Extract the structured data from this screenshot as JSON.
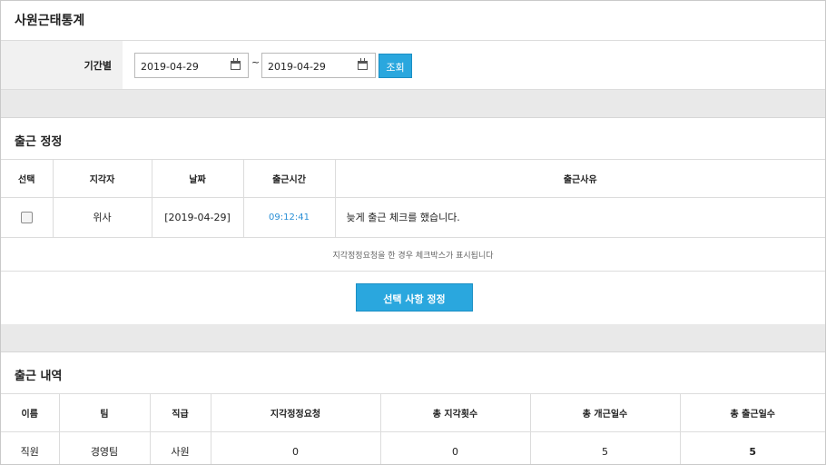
{
  "page": {
    "title": "사원근태통계"
  },
  "filter": {
    "label": "기간별",
    "start_date": "2019-04-29",
    "separator": "~",
    "end_date": "2019-04-29",
    "search_label": "조회"
  },
  "correction": {
    "title": "출근 정정",
    "columns": [
      "선택",
      "지각자",
      "날짜",
      "출근시간",
      "출근사유"
    ],
    "rows": [
      {
        "checked": false,
        "name": "위사",
        "date": "[2019-04-29]",
        "time": "09:12:41",
        "reason": "늦게 출근 체크를 했습니다."
      }
    ],
    "notice": "지각정정요청을 한 경우 체크박스가 표시됩니다",
    "submit_label": "선택 사항 정정"
  },
  "history": {
    "title": "출근 내역",
    "columns": [
      "이름",
      "팀",
      "직급",
      "지각정정요청",
      "총 지각횟수",
      "총 개근일수",
      "총 출근일수"
    ],
    "rows": [
      {
        "name": "직원",
        "team": "경영팀",
        "rank": "사원",
        "late_requests": "0",
        "total_late": "0",
        "perfect_days": "5",
        "work_days": "5"
      }
    ]
  },
  "colors": {
    "accent": "#2aa7de",
    "time_text": "#2a8fd6",
    "band": "#e9e9e9"
  },
  "icons": {
    "date_picker": "calendar-icon"
  }
}
